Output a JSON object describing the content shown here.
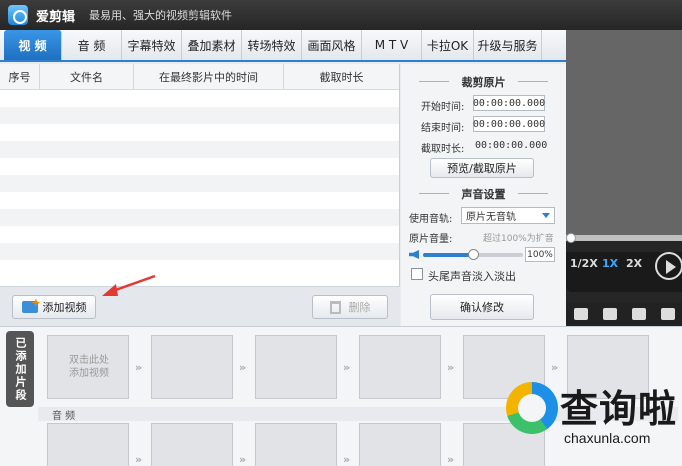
{
  "titlebar": {
    "app_name": "爱剪辑",
    "tagline": "最易用、强大的视频剪辑软件"
  },
  "menu": [
    {
      "label": "视 频",
      "active": true
    },
    {
      "label": "音 频"
    },
    {
      "label": "字幕特效"
    },
    {
      "label": "叠加素材"
    },
    {
      "label": "转场特效"
    },
    {
      "label": "画面风格"
    },
    {
      "label": "M T V"
    },
    {
      "label": "卡拉OK"
    },
    {
      "label": "升级与服务"
    }
  ],
  "table": {
    "columns": [
      "序号",
      "文件名",
      "在最终影片中的时间",
      "截取时长"
    ]
  },
  "table_tools": {
    "add_video": "添加视频",
    "delete": "删除"
  },
  "clip_panel": {
    "cut_title": "裁剪原片",
    "start_label": "开始时间:",
    "start_value": "00:00:00.000",
    "end_label": "结束时间:",
    "end_value": "00:00:00.000",
    "duration_label": "截取时长:",
    "duration_value": "00:00:00.000",
    "preview_button": "预览/截取原片",
    "sound_title": "声音设置",
    "track_label": "使用音轨:",
    "track_value": "原片无音轨",
    "volume_label": "原片音量:",
    "volume_hint": "超过100%为扩音",
    "volume_value": "100%",
    "volume_level": 0.5,
    "fade_label": "头尾声音淡入淡出",
    "confirm_button": "确认修改"
  },
  "player": {
    "speed_half": "1/2X",
    "speed_1x": "1X",
    "speed_2x": "2X",
    "progress": 0
  },
  "timeline": {
    "side_tab": "已添加片段",
    "placeholder": "双击此处\n添加视频",
    "audio_label": "音 频",
    "chevron": "»"
  },
  "watermark": {
    "cn": "查询啦",
    "en": "chaxunla.com"
  },
  "colors": {
    "accent": "#2d7fd0",
    "titlebar": "#2b2b2b",
    "arrow": "#e23a32"
  }
}
